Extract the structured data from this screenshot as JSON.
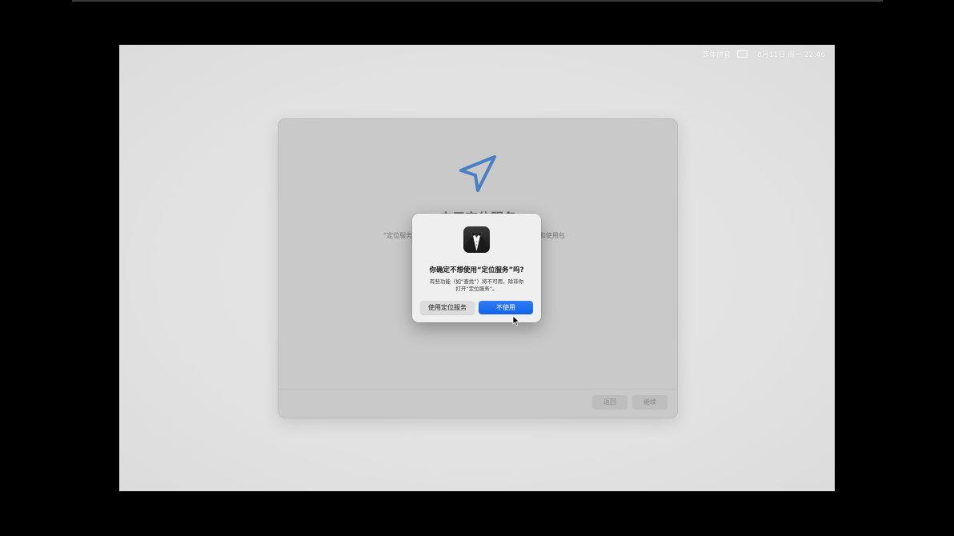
{
  "menubar": {
    "input_method": "简体拼音",
    "datetime": "8月11日 周一 22:46"
  },
  "setup_window": {
    "title": "启用定位服务",
    "body_left": "“定位服务",
    "body_right": "和使用包",
    "back_label": "返回",
    "continue_label": "继续",
    "icon": "location-arrow-icon",
    "accent": "#4a7fc4"
  },
  "dialog": {
    "icon": "tuxedo-app-icon",
    "title": "你确定不想使用“定位服务”吗?",
    "message_line1": "有些功能（如“查找”）将不可用，除非你",
    "message_line2": "打开“定位服务”。",
    "secondary_label": "使用定位服务",
    "primary_label": "不使用",
    "primary_color": "#1a6cf0"
  }
}
